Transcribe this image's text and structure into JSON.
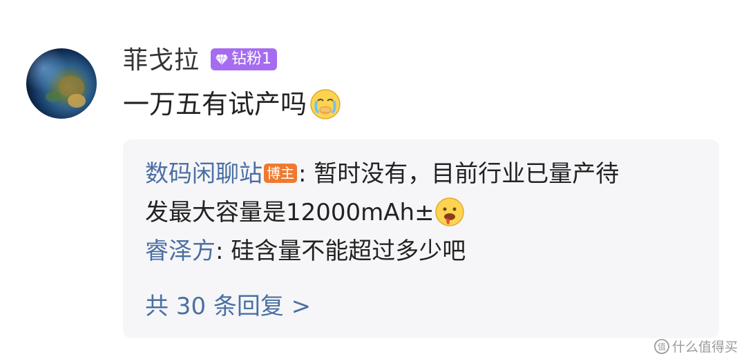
{
  "comment": {
    "avatar_icon": "earth-avatar",
    "username": "菲戈拉",
    "badge": {
      "icon": "diamond-icon",
      "label": "钻粉1",
      "color": "#a56cf0"
    },
    "text": "一万五有试产吗",
    "emoji": "crying-face-emoji"
  },
  "replies": [
    {
      "author": "数码闲聊站",
      "author_badge": "博主",
      "separator": ": ",
      "text_line1": "暂时没有，目前行业已量产待",
      "text_line2": "发最大容量是12000mAh±",
      "emoji": "drooling-face-emoji"
    },
    {
      "author": "睿泽方",
      "separator": ": ",
      "text": "硅含量不能超过多少吧"
    }
  ],
  "more_replies": "共 30 条回复 >",
  "watermark": {
    "icon": "smzdm-logo-icon",
    "text": "什么值得买"
  },
  "colors": {
    "link": "#4a6fa3",
    "host_badge": "#ee7a30",
    "panel_bg": "#f6f6f8"
  }
}
